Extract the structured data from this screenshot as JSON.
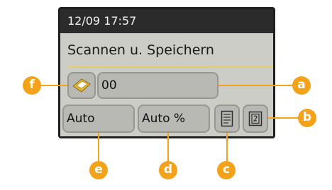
{
  "status": {
    "datetime": "12/09 17:57"
  },
  "main": {
    "title": "Scannen u. Speichern"
  },
  "fields": {
    "number": "00",
    "resolution": "Auto",
    "zoom": "Auto %"
  },
  "icons": {
    "storage": "storage-icon",
    "document": "document-icon",
    "duplex": "duplex-icon"
  },
  "callouts": {
    "a": "a",
    "b": "b",
    "c": "c",
    "d": "d",
    "e": "e",
    "f": "f"
  },
  "colors": {
    "accent": "#f3a21a",
    "panel": "#cdcdc7",
    "field": "#b8b8b4"
  }
}
